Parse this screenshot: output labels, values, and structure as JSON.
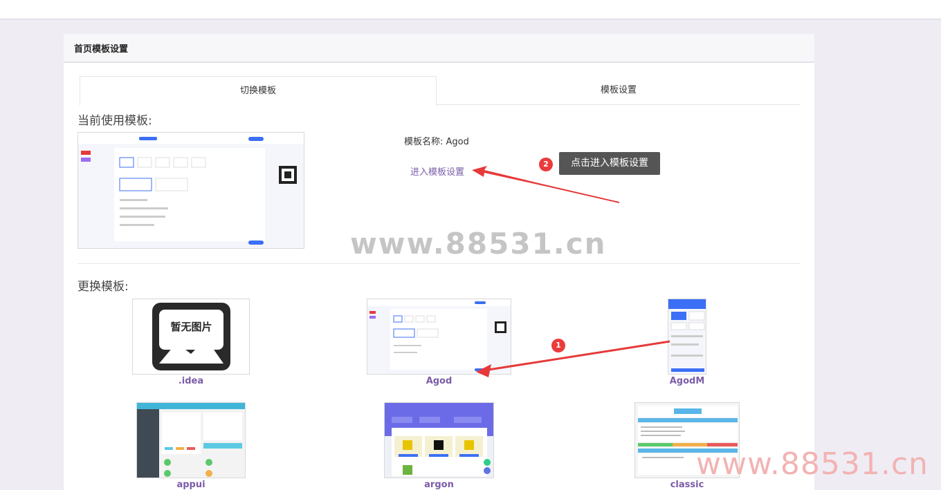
{
  "header": {
    "title": "首页模板设置"
  },
  "tabs": [
    {
      "label": "切换模板"
    },
    {
      "label": "模板设置"
    }
  ],
  "current": {
    "section_title": "当前使用模板:",
    "name_label": "模板名称: Agod",
    "enter_link": "进入模板设置",
    "tooltip": "点击进入模板设置",
    "badge": "2"
  },
  "change": {
    "section_title": "更换模板:",
    "badge": "1",
    "templates": [
      {
        "name": ".idea",
        "placeholder": "暂无图片"
      },
      {
        "name": "Agod"
      },
      {
        "name": "AgodM"
      },
      {
        "name": "appui"
      },
      {
        "name": "argon"
      },
      {
        "name": "classic"
      }
    ]
  },
  "watermark": "www.88531.cn",
  "colors": {
    "accent": "#7b5ca8",
    "annotation_red": "#ea3b3b",
    "tooltip_bg": "#555555"
  }
}
